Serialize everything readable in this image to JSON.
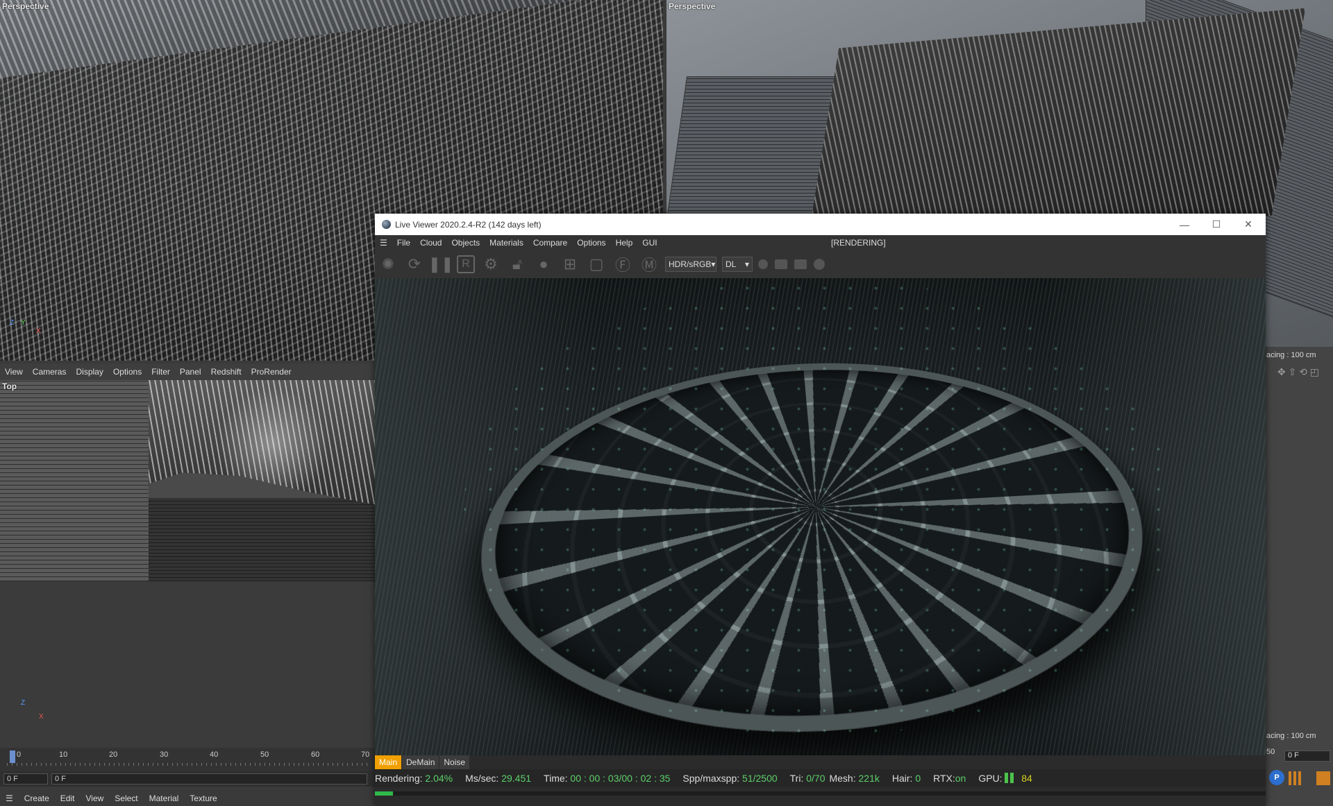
{
  "viewports": {
    "top_left_label": "Perspective",
    "top_right_label": "Perspective",
    "top_view_label": "Top"
  },
  "left_menu": [
    "View",
    "Cameras",
    "Display",
    "Options",
    "Filter",
    "Panel",
    "Redshift",
    "ProRender"
  ],
  "axes": {
    "x": "X",
    "y": "Y",
    "z": "Z"
  },
  "timeline": {
    "ticks": [
      "0",
      "10",
      "20",
      "30",
      "40",
      "50",
      "60",
      "70"
    ],
    "current_frame": "0 F",
    "frame_display": "0 F"
  },
  "bottom_menu": [
    "Create",
    "Edit",
    "View",
    "Select",
    "Material",
    "Texture"
  ],
  "side_panel": {
    "spacing_1": "acing : 100 cm",
    "spacing_2": "acing : 100 cm",
    "frame_tick": "50",
    "frame_field": "0 F"
  },
  "live_viewer": {
    "title": "Live Viewer 2020.2.4-R2 (142 days left)",
    "menu": [
      "File",
      "Cloud",
      "Objects",
      "Materials",
      "Compare",
      "Options",
      "Help",
      "GUI"
    ],
    "state": "[RENDERING]",
    "color_space": "HDR/sRGB",
    "mode": "DL",
    "tabs": [
      "Main",
      "DeMain",
      "Noise"
    ],
    "status": {
      "rendering_label": "Rendering:",
      "rendering_value": "2.04%",
      "mssec_label": "Ms/sec:",
      "mssec_value": "29.451",
      "time_label": "Time:",
      "time_value": "00 : 00 : 03/00 : 02 : 35",
      "spp_label": "Spp/maxspp:",
      "spp_value": "51/2500",
      "tri_label": "Tri:",
      "tri_value": "0/70",
      "mesh_label": "Mesh:",
      "mesh_value": "221k",
      "hair_label": "Hair:",
      "hair_value": "0",
      "rtx_label": "RTX:",
      "rtx_value": "on",
      "gpu_label": "GPU:",
      "gpu_value": "84"
    },
    "progress": 0.0204
  }
}
